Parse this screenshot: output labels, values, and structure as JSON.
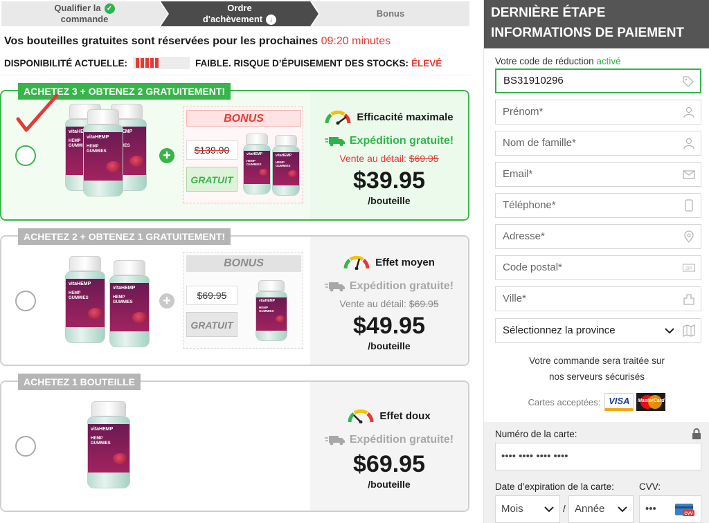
{
  "steps": [
    {
      "label_1": "Qualifier la",
      "label_2": "commande",
      "state": "done"
    },
    {
      "label_1": "Ordre",
      "label_2": "d'achèvement",
      "state": "current"
    },
    {
      "label": "Bonus",
      "state": "upcoming"
    }
  ],
  "reservation": {
    "text": "Vos bouteilles gratuites sont réservées pour les prochaines",
    "timer": "09:20 minutes"
  },
  "stock": {
    "label": "DISPONIBILITÉ ACTUELLE:",
    "level_text": "FAIBLE. RISQUE D’ÉPUISEMENT DES STOCKS:",
    "risk": "ÉLEVÉ",
    "bar_fill": 0.4
  },
  "offers": [
    {
      "tag": "ACHETEZ 3 + OBTENEZ 2 GRATUITEMENT!",
      "selected": true,
      "bonus_label": "BONUS",
      "old_price": "$139.90",
      "free_label": "GRATUIT",
      "effect": "Efficacité maximale",
      "shipping": "Expédition gratuite!",
      "retail_label": "Vente au détail:",
      "retail_price": "$69.95",
      "price": "$39.95",
      "per": "/bouteille"
    },
    {
      "tag": "ACHETEZ 2 + OBTENEZ 1 GRATUITEMENT!",
      "selected": false,
      "bonus_label": "BONUS",
      "old_price": "$69.95",
      "free_label": "GRATUIT",
      "effect": "Effet moyen",
      "shipping": "Expédition gratuite!",
      "retail_label": "Vente au détail:",
      "retail_price": "$69.95",
      "price": "$49.95",
      "per": "/bouteille"
    },
    {
      "tag": "ACHETEZ 1 BOUTEILLE",
      "selected": false,
      "effect": "Effet doux",
      "shipping": "Expédition gratuite!",
      "price": "$69.95",
      "per": "/bouteille"
    }
  ],
  "product": {
    "brand": "vitaHEMP",
    "name_1": "HEMP",
    "name_2": "GUMMIES"
  },
  "panel": {
    "title_1": "DERNIÈRE ÉTAPE",
    "title_2": "INFORMATIONS DE PAIEMENT",
    "promo_label": "Votre code de réduction",
    "promo_status": "activé",
    "promo_value": "BS31910296",
    "fields": {
      "first_name": "Prénom*",
      "last_name": "Nom de famille*",
      "email": "Email*",
      "phone": "Téléphone*",
      "address": "Adresse*",
      "postal": "Code postal*",
      "city": "Ville*",
      "province": "Sélectionnez la province"
    },
    "secure_1": "Votre commande sera traitée sur",
    "secure_2": "nos serveurs sécurisés",
    "cards_label": "Cartes acceptées:",
    "visa": "VISA",
    "mastercard": "MasterCard",
    "card_number_label": "Numéro de la carte:",
    "card_number_placeholder": "•••• •••• •••• ••••",
    "expiry_label": "Date d’expiration de la carte:",
    "cvv_label": "CVV:",
    "month": "Mois",
    "year": "Année",
    "slash": "/",
    "cvv_placeholder": "•••",
    "cvv_icon_text": "CVV",
    "zip_icon_text": "ZIP"
  },
  "colors": {
    "green": "#38b54a",
    "red": "#e53935",
    "panel_header": "#555555"
  }
}
